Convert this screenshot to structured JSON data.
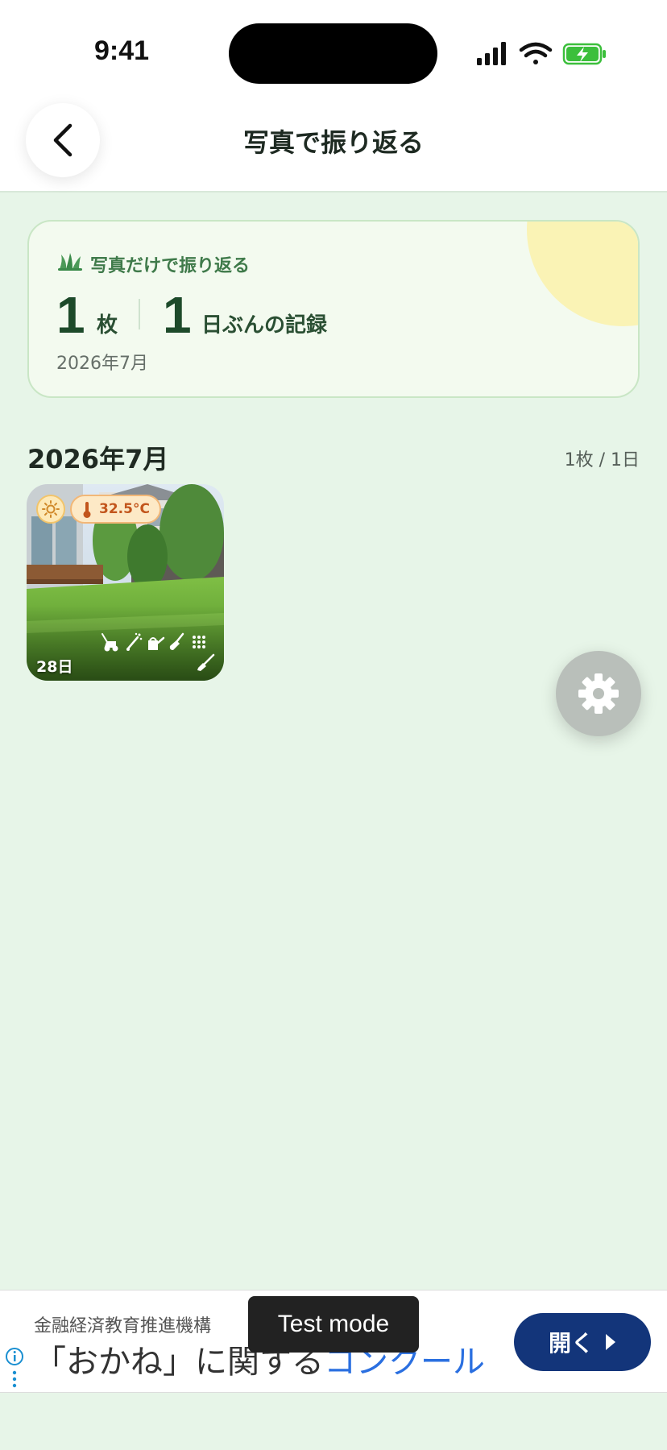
{
  "status_bar": {
    "time": "9:41"
  },
  "header": {
    "title": "写真で振り返る"
  },
  "summary": {
    "label": "写真だけで振り返る",
    "photo_count": "1",
    "photo_unit": "枚",
    "day_count": "1",
    "day_unit": "日ぶんの記録",
    "period": "2026年7月"
  },
  "month": {
    "title": "2026年7月",
    "count": "1枚 / 1日",
    "photos": [
      {
        "temperature": "32.5°C",
        "day": "28日",
        "weather_icon": "sun-icon",
        "activity_icons": [
          "lawnmower-icon",
          "sprinkler-icon",
          "watering-can-icon",
          "shovel-icon",
          "grid-icon",
          "broom-icon"
        ]
      }
    ]
  },
  "fab": {
    "icon": "gear-icon"
  },
  "ad": {
    "sponsor": "金融経済教育推進機構",
    "headline_start": "「おかね」に関する",
    "headline_highlight": "コンクール",
    "cta": "開く",
    "badge": "Test mode"
  },
  "colors": {
    "background": "#e7f5e8",
    "accent_green": "#3f7a4a",
    "temperature": "#c2551c",
    "ad_button": "#13357a"
  }
}
